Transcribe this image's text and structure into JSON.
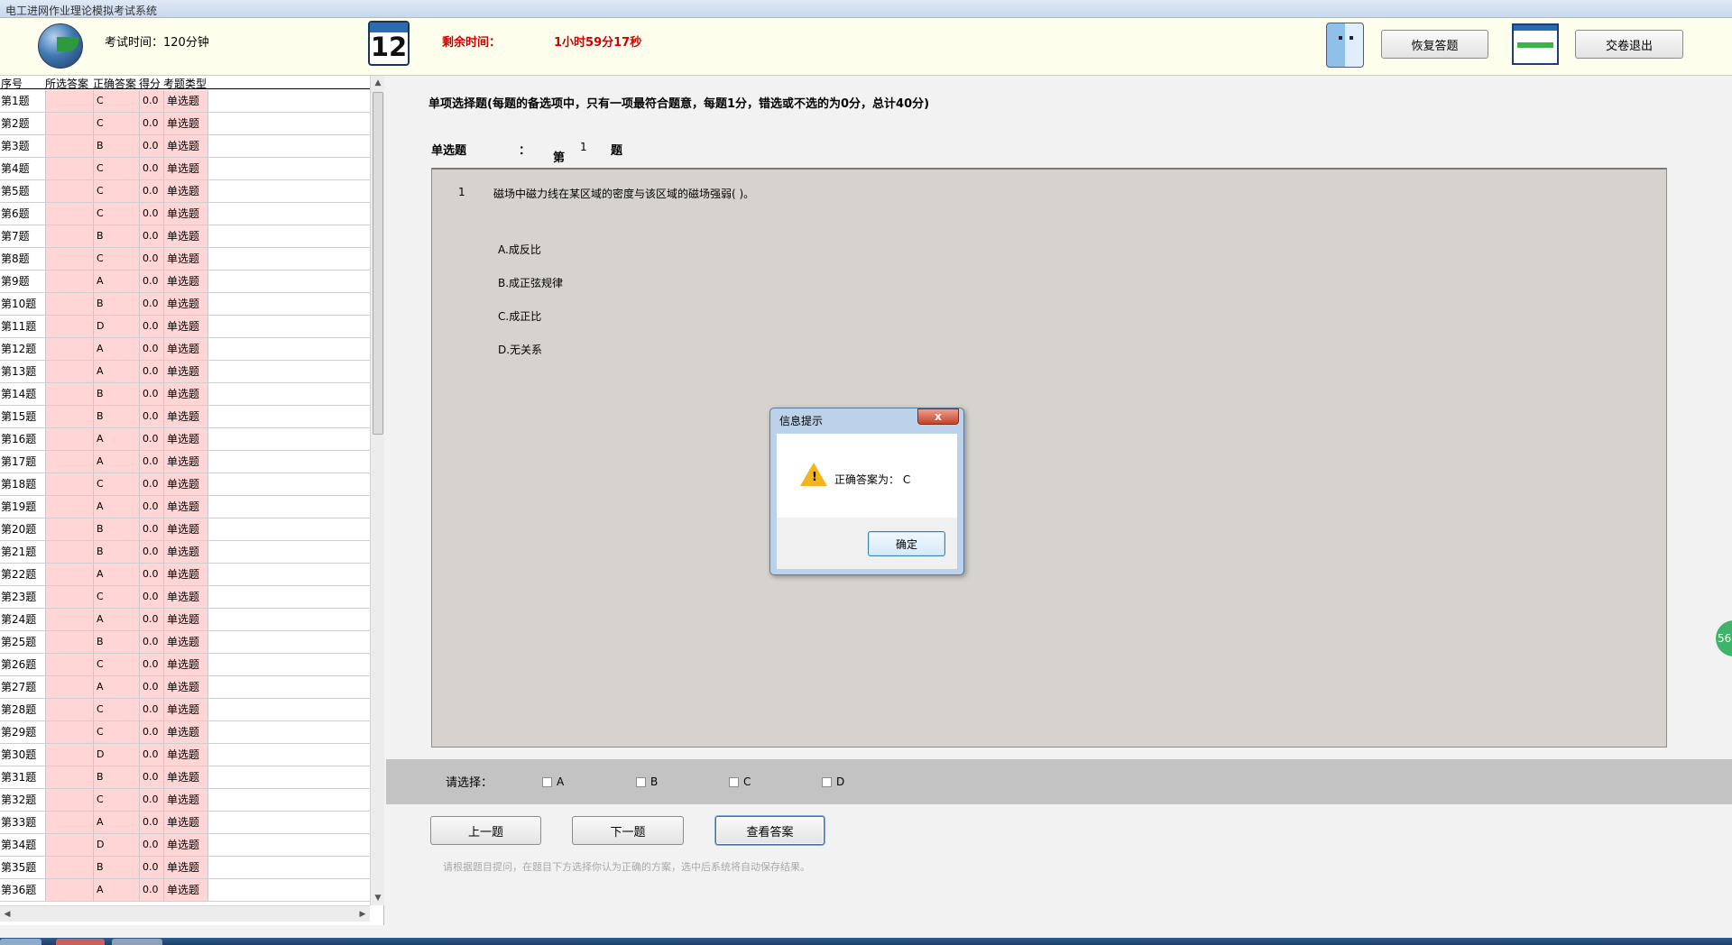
{
  "window": {
    "title": "电工进网作业理论模拟考试系统"
  },
  "header": {
    "exam_time": "考试时间：120分钟",
    "calendar_day": "12",
    "remaining_label": "剩余时间：",
    "remaining_value": "1小时59分17秒",
    "restore_label": "恢复答题",
    "submit_label": "交卷退出"
  },
  "table": {
    "headers": [
      "序号",
      "所选答案",
      "正确答案",
      "得分",
      "考题类型"
    ],
    "rows": [
      {
        "num": "第1题",
        "sel": "",
        "ans": "C",
        "score": "0.0",
        "type": "单选题"
      },
      {
        "num": "第2题",
        "sel": "",
        "ans": "C",
        "score": "0.0",
        "type": "单选题"
      },
      {
        "num": "第3题",
        "sel": "",
        "ans": "B",
        "score": "0.0",
        "type": "单选题"
      },
      {
        "num": "第4题",
        "sel": "",
        "ans": "C",
        "score": "0.0",
        "type": "单选题"
      },
      {
        "num": "第5题",
        "sel": "",
        "ans": "C",
        "score": "0.0",
        "type": "单选题"
      },
      {
        "num": "第6题",
        "sel": "",
        "ans": "C",
        "score": "0.0",
        "type": "单选题"
      },
      {
        "num": "第7题",
        "sel": "",
        "ans": "B",
        "score": "0.0",
        "type": "单选题"
      },
      {
        "num": "第8题",
        "sel": "",
        "ans": "C",
        "score": "0.0",
        "type": "单选题"
      },
      {
        "num": "第9题",
        "sel": "",
        "ans": "A",
        "score": "0.0",
        "type": "单选题"
      },
      {
        "num": "第10题",
        "sel": "",
        "ans": "B",
        "score": "0.0",
        "type": "单选题"
      },
      {
        "num": "第11题",
        "sel": "",
        "ans": "D",
        "score": "0.0",
        "type": "单选题"
      },
      {
        "num": "第12题",
        "sel": "",
        "ans": "A",
        "score": "0.0",
        "type": "单选题"
      },
      {
        "num": "第13题",
        "sel": "",
        "ans": "A",
        "score": "0.0",
        "type": "单选题"
      },
      {
        "num": "第14题",
        "sel": "",
        "ans": "B",
        "score": "0.0",
        "type": "单选题"
      },
      {
        "num": "第15题",
        "sel": "",
        "ans": "B",
        "score": "0.0",
        "type": "单选题"
      },
      {
        "num": "第16题",
        "sel": "",
        "ans": "A",
        "score": "0.0",
        "type": "单选题"
      },
      {
        "num": "第17题",
        "sel": "",
        "ans": "A",
        "score": "0.0",
        "type": "单选题"
      },
      {
        "num": "第18题",
        "sel": "",
        "ans": "C",
        "score": "0.0",
        "type": "单选题"
      },
      {
        "num": "第19题",
        "sel": "",
        "ans": "A",
        "score": "0.0",
        "type": "单选题"
      },
      {
        "num": "第20题",
        "sel": "",
        "ans": "B",
        "score": "0.0",
        "type": "单选题"
      },
      {
        "num": "第21题",
        "sel": "",
        "ans": "B",
        "score": "0.0",
        "type": "单选题"
      },
      {
        "num": "第22题",
        "sel": "",
        "ans": "A",
        "score": "0.0",
        "type": "单选题"
      },
      {
        "num": "第23题",
        "sel": "",
        "ans": "C",
        "score": "0.0",
        "type": "单选题"
      },
      {
        "num": "第24题",
        "sel": "",
        "ans": "A",
        "score": "0.0",
        "type": "单选题"
      },
      {
        "num": "第25题",
        "sel": "",
        "ans": "B",
        "score": "0.0",
        "type": "单选题"
      },
      {
        "num": "第26题",
        "sel": "",
        "ans": "C",
        "score": "0.0",
        "type": "单选题"
      },
      {
        "num": "第27题",
        "sel": "",
        "ans": "A",
        "score": "0.0",
        "type": "单选题"
      },
      {
        "num": "第28题",
        "sel": "",
        "ans": "C",
        "score": "0.0",
        "type": "单选题"
      },
      {
        "num": "第29题",
        "sel": "",
        "ans": "C",
        "score": "0.0",
        "type": "单选题"
      },
      {
        "num": "第30题",
        "sel": "",
        "ans": "D",
        "score": "0.0",
        "type": "单选题"
      },
      {
        "num": "第31题",
        "sel": "",
        "ans": "B",
        "score": "0.0",
        "type": "单选题"
      },
      {
        "num": "第32题",
        "sel": "",
        "ans": "C",
        "score": "0.0",
        "type": "单选题"
      },
      {
        "num": "第33题",
        "sel": "",
        "ans": "A",
        "score": "0.0",
        "type": "单选题"
      },
      {
        "num": "第34题",
        "sel": "",
        "ans": "D",
        "score": "0.0",
        "type": "单选题"
      },
      {
        "num": "第35题",
        "sel": "",
        "ans": "B",
        "score": "0.0",
        "type": "单选题"
      },
      {
        "num": "第36题",
        "sel": "",
        "ans": "A",
        "score": "0.0",
        "type": "单选题"
      }
    ]
  },
  "question": {
    "heading": "单项选择题(每题的备选项中，只有一项最符合题意，每题1分，错选或不选的为0分，总计40分)",
    "type_label": "单选题",
    "colon": "：",
    "di": "第",
    "number": "1",
    "ti": "题",
    "index": "1",
    "text": "磁场中磁力线在某区域的密度与该区域的磁场强弱(   )。",
    "options": [
      "A.成反比",
      "B.成正弦规律",
      "C.成正比",
      "D.无关系"
    ]
  },
  "answer": {
    "choose_label": "请选择：",
    "checkboxes": [
      "A",
      "B",
      "C",
      "D"
    ]
  },
  "nav": {
    "prev_label": "上一题",
    "next_label": "下一题",
    "view_label": "查看答案",
    "hint": "请根据题目提问，在题目下方选择你认为正确的方案，选中后系统将自动保存结果。"
  },
  "floating_badge": "56",
  "dialog": {
    "title": "信息提示",
    "close_glyph": "x",
    "message": "正确答案为：  C",
    "ok_label": "确定"
  },
  "colors": {
    "remaining_time": "#d00000",
    "table_cell_pink": "#ffd5d5",
    "question_bg": "#d6d3ce",
    "answer_bar": "#c3c3c3"
  }
}
